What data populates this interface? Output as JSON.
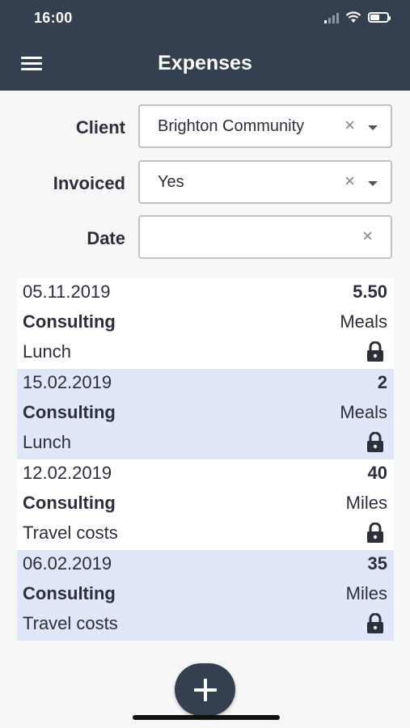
{
  "status_bar": {
    "time": "16:00"
  },
  "header": {
    "title": "Expenses",
    "menu_icon": "hamburger-menu-icon"
  },
  "filters": {
    "client": {
      "label": "Client",
      "value": "Brighton Community"
    },
    "invoiced": {
      "label": "Invoiced",
      "value": "Yes"
    },
    "date": {
      "label": "Date",
      "value": ""
    }
  },
  "clear_symbol": "×",
  "expenses": [
    {
      "date": "05.11.2019",
      "amount": "5.50",
      "project": "Consulting",
      "category": "Meals",
      "description": "Lunch",
      "locked": true
    },
    {
      "date": "15.02.2019",
      "amount": "2",
      "project": "Consulting",
      "category": "Meals",
      "description": "Lunch",
      "locked": true
    },
    {
      "date": "12.02.2019",
      "amount": "40",
      "project": "Consulting",
      "category": "Miles",
      "description": "Travel costs",
      "locked": true
    },
    {
      "date": "06.02.2019",
      "amount": "35",
      "project": "Consulting",
      "category": "Miles",
      "description": "Travel costs",
      "locked": true
    }
  ],
  "fab": {
    "icon": "plus-icon"
  },
  "colors": {
    "header": "#34404f",
    "row_alt": "#dfe7f8"
  }
}
